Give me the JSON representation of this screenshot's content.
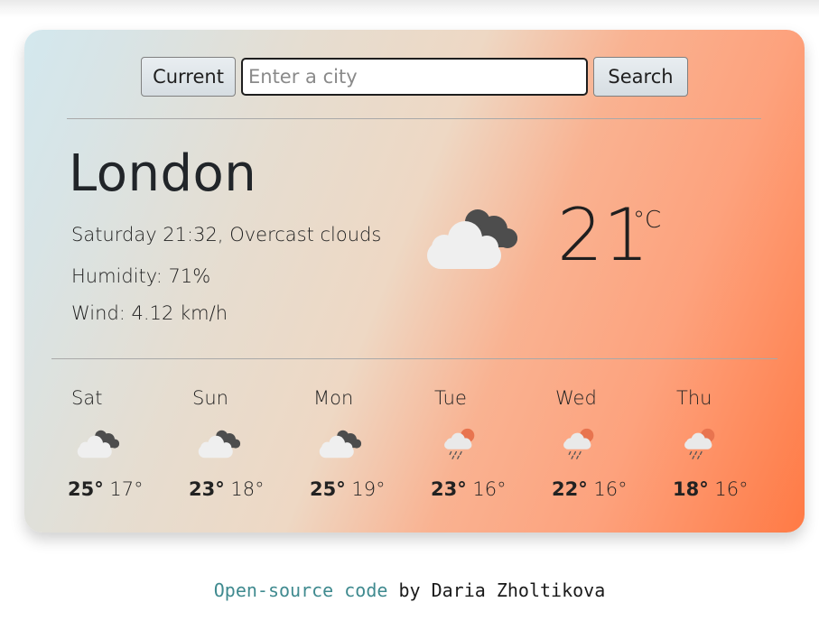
{
  "search": {
    "current_label": "Current",
    "placeholder": "Enter a city",
    "value": "",
    "search_label": "Search"
  },
  "current": {
    "city": "London",
    "datetime": "Saturday 21:32",
    "description": "Overcast clouds",
    "humidity_label": "Humidity:",
    "humidity_value": "71",
    "humidity_unit": "%",
    "wind_label": "Wind:",
    "wind_value": "4.12",
    "wind_unit": "km/h",
    "icon": "overcast-clouds-icon",
    "temperature": "21",
    "unit": "°C"
  },
  "forecast": [
    {
      "day": "Sat",
      "icon": "overcast-clouds-icon",
      "max": "25°",
      "min": "17°"
    },
    {
      "day": "Sun",
      "icon": "overcast-clouds-icon",
      "max": "23°",
      "min": "18°"
    },
    {
      "day": "Mon",
      "icon": "overcast-clouds-icon",
      "max": "25°",
      "min": "19°"
    },
    {
      "day": "Tue",
      "icon": "rain-sun-icon",
      "max": "23°",
      "min": "16°"
    },
    {
      "day": "Wed",
      "icon": "rain-sun-icon",
      "max": "22°",
      "min": "16°"
    },
    {
      "day": "Thu",
      "icon": "rain-sun-icon",
      "max": "18°",
      "min": "16°"
    }
  ],
  "footer": {
    "link_text": "Open-source code",
    "by_text": "by Daria Zholtikova"
  },
  "colors": {
    "link": "#3f8a8f",
    "card_gradient_start": "#d3e8ee",
    "card_gradient_end": "#ff7a45"
  }
}
